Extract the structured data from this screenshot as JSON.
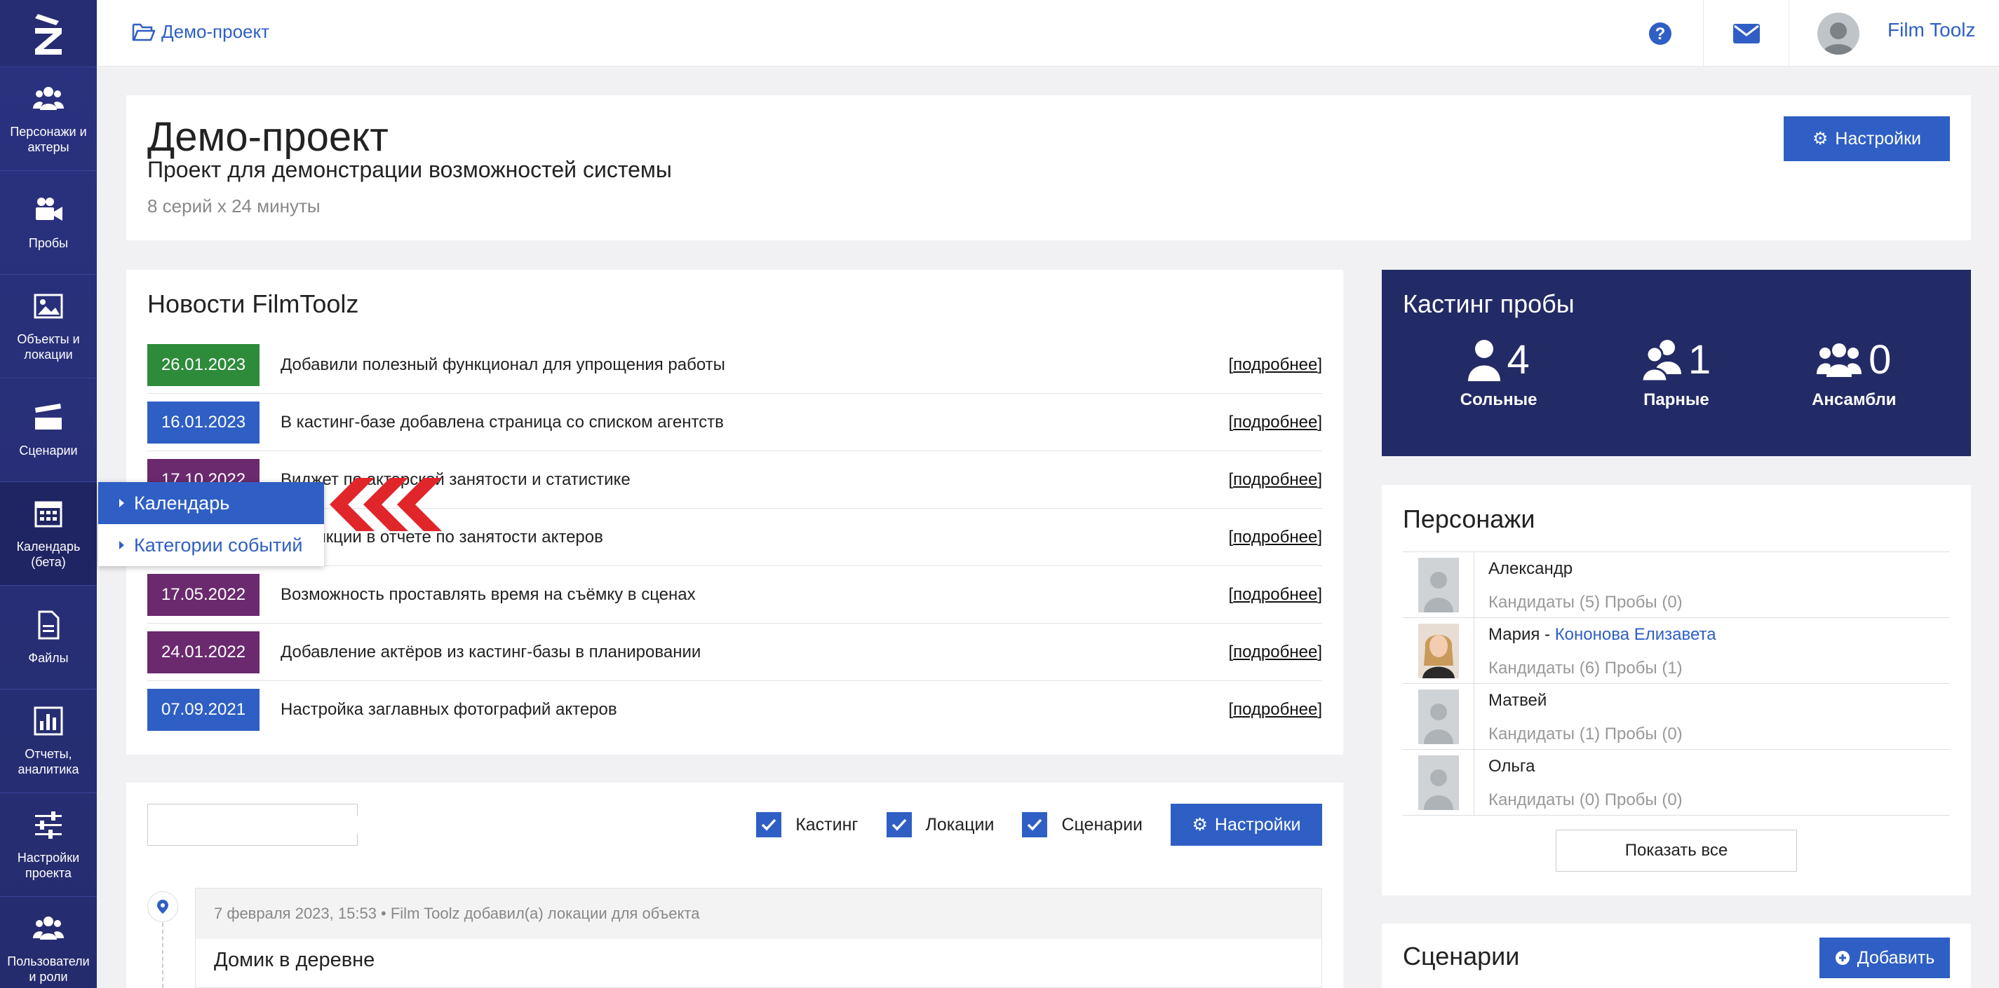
{
  "sidebar": {
    "items": [
      {
        "label": "Персонажи и актеры",
        "icon": "users-icon"
      },
      {
        "label": "Пробы",
        "icon": "video-camera-icon"
      },
      {
        "label": "Объекты и локации",
        "icon": "image-icon"
      },
      {
        "label": "Сценарии",
        "icon": "clapperboard-icon"
      },
      {
        "label": "Календарь (бета)",
        "icon": "calendar-icon"
      },
      {
        "label": "Файлы",
        "icon": "file-icon"
      },
      {
        "label": "Отчеты, аналитика",
        "icon": "bar-chart-icon"
      },
      {
        "label": "Настройки проекта",
        "icon": "sliders-icon"
      },
      {
        "label": "Пользователи и роли",
        "icon": "users-icon"
      }
    ]
  },
  "topbar": {
    "breadcrumb": "Демо-проект",
    "user_name": "Film Toolz"
  },
  "project": {
    "title": "Демо-проект",
    "subtitle": "Проект для демонстрации возможностей системы",
    "meta": "8 серий x 24 минуты",
    "settings_label": "Настройки"
  },
  "news": {
    "title": "Новости FilmToolz",
    "more_label": "подробнее",
    "items": [
      {
        "date": "26.01.2023",
        "text": "Добавили полезный функционал для упрощения работы",
        "color": "#2e8b3a"
      },
      {
        "date": "16.01.2023",
        "text": "В кастинг-базе добавлена страница со списком агентств",
        "color": "#2f5fc4"
      },
      {
        "date": "17.10.2022",
        "text": "Виджет по актерской занятости и статистике",
        "color": "#6b2a6e"
      },
      {
        "date": "",
        "text": "е функции в отчете по занятости актеров",
        "color": "#6b2a6e"
      },
      {
        "date": "17.05.2022",
        "text": "Возможность проставлять время на съёмку в сценах",
        "color": "#6b2a6e"
      },
      {
        "date": "24.01.2022",
        "text": "Добавление актёров из кастинг-базы в планировании",
        "color": "#6b2a6e"
      },
      {
        "date": "07.09.2021",
        "text": "Настройка заглавных фотографий актеров",
        "color": "#2f5fc4"
      }
    ]
  },
  "casting": {
    "title": "Кастинг пробы",
    "stats": [
      {
        "value": "4",
        "label": "Сольные",
        "icon": "user-icon"
      },
      {
        "value": "1",
        "label": "Парные",
        "icon": "user-pair-icon"
      },
      {
        "value": "0",
        "label": "Ансамбли",
        "icon": "users-group-icon"
      }
    ]
  },
  "characters": {
    "title": "Персонажи",
    "items": [
      {
        "name": "Александр",
        "actor": "",
        "stats": "Кандидаты (5)  Пробы (0)",
        "photo": false
      },
      {
        "name": "Мария - ",
        "actor": "Кононова Елизавета",
        "stats": "Кандидаты (6)  Пробы (1)",
        "photo": true
      },
      {
        "name": "Матвей",
        "actor": "",
        "stats": "Кандидаты (1)  Пробы (0)",
        "photo": false
      },
      {
        "name": "Ольга",
        "actor": "",
        "stats": "Кандидаты (0)  Пробы (0)",
        "photo": false
      }
    ],
    "show_all_label": "Показать все"
  },
  "feed": {
    "search_placeholder": "",
    "filters": [
      "Кастинг",
      "Локации",
      "Сценарии"
    ],
    "settings_label": "Настройки",
    "entry_head": "7 февраля 2023, 15:53 • Film Toolz добавил(а) локации для объекта",
    "entry_title": "Домик в деревне"
  },
  "scenarios": {
    "title": "Сценарии",
    "add_label": "Добавить"
  },
  "dropdown": {
    "items": [
      "Календарь",
      "Категории событий"
    ]
  },
  "colors": {
    "accent": "#2f5fc4",
    "sidebar": "#2a3280",
    "casting_bg": "#232b66"
  }
}
